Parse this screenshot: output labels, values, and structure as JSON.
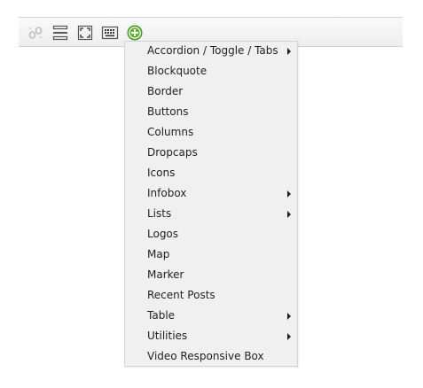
{
  "toolbar": {
    "buttons": [
      {
        "icon": "unlink-icon"
      },
      {
        "icon": "horizontal-rule-icon"
      },
      {
        "icon": "fullscreen-icon"
      },
      {
        "icon": "keyboard-icon"
      },
      {
        "icon": "add-shortcode-icon",
        "accent": "#5cb82f"
      }
    ]
  },
  "menu": {
    "items": [
      {
        "label": "Accordion / Toggle / Tabs",
        "has_submenu": true
      },
      {
        "label": "Blockquote",
        "has_submenu": false
      },
      {
        "label": "Border",
        "has_submenu": false
      },
      {
        "label": "Buttons",
        "has_submenu": false
      },
      {
        "label": "Columns",
        "has_submenu": false
      },
      {
        "label": "Dropcaps",
        "has_submenu": false
      },
      {
        "label": "Icons",
        "has_submenu": false
      },
      {
        "label": "Infobox",
        "has_submenu": true
      },
      {
        "label": "Lists",
        "has_submenu": true
      },
      {
        "label": "Logos",
        "has_submenu": false
      },
      {
        "label": "Map",
        "has_submenu": false
      },
      {
        "label": "Marker",
        "has_submenu": false
      },
      {
        "label": "Recent Posts",
        "has_submenu": false
      },
      {
        "label": "Table",
        "has_submenu": true
      },
      {
        "label": "Utilities",
        "has_submenu": true
      },
      {
        "label": "Video Responsive Box",
        "has_submenu": false
      }
    ]
  }
}
